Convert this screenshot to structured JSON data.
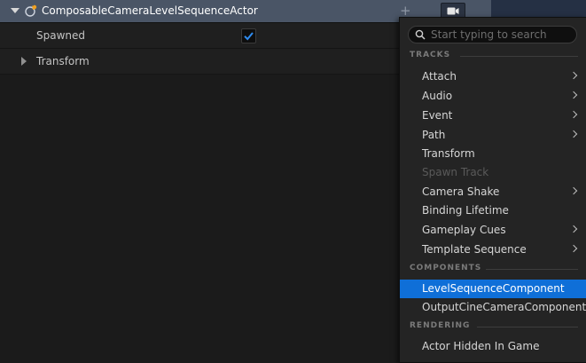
{
  "binding": {
    "actor_name": "ComposableCameraLevelSequenceActor",
    "add_track_symbol": "+",
    "icon": "actor-icon"
  },
  "properties": [
    {
      "label": "Spawned",
      "type": "checkbox",
      "checked": true
    },
    {
      "label": "Transform",
      "type": "expandable"
    }
  ],
  "menu": {
    "search_placeholder": "Start typing to search",
    "search_value": "",
    "sections": [
      {
        "header": "TRACKS",
        "items": [
          {
            "label": "Attach",
            "submenu": true,
            "enabled": true
          },
          {
            "label": "Audio",
            "submenu": true,
            "enabled": true
          },
          {
            "label": "Event",
            "submenu": true,
            "enabled": true
          },
          {
            "label": "Path",
            "submenu": true,
            "enabled": true
          },
          {
            "label": "Transform",
            "submenu": false,
            "enabled": true
          },
          {
            "label": "Spawn Track",
            "submenu": false,
            "enabled": false
          },
          {
            "label": "Camera Shake",
            "submenu": true,
            "enabled": true
          },
          {
            "label": "Binding Lifetime",
            "submenu": false,
            "enabled": true
          },
          {
            "label": "Gameplay Cues",
            "submenu": true,
            "enabled": true
          },
          {
            "label": "Template Sequence",
            "submenu": true,
            "enabled": true
          }
        ]
      },
      {
        "header": "COMPONENTS",
        "items": [
          {
            "label": "LevelSequenceComponent",
            "submenu": false,
            "enabled": true,
            "selected": true
          },
          {
            "label": "OutputCineCameraComponent",
            "submenu": false,
            "enabled": true
          }
        ]
      },
      {
        "header": "RENDERING",
        "items": [
          {
            "label": "Actor Hidden In Game",
            "submenu": false,
            "enabled": true
          }
        ]
      }
    ]
  },
  "colors": {
    "binding_row": "#4a5566",
    "menu_bg": "#242424",
    "selection": "#0f6fd8",
    "checkbox_check": "#2f8cf0"
  }
}
